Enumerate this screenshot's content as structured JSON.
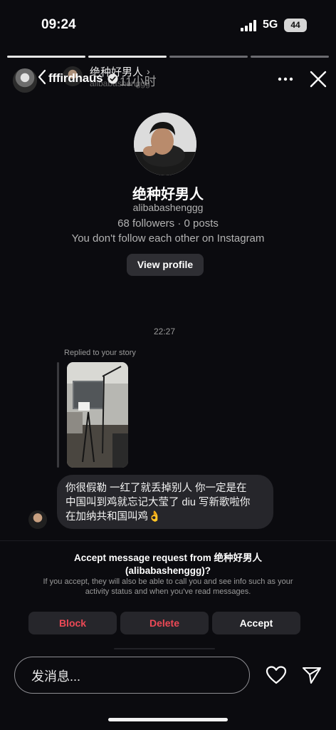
{
  "status_bar": {
    "time": "09:24",
    "network": "5G",
    "battery": "44"
  },
  "story_header": {
    "username": "fffirdhaus",
    "time_ago": "11小时",
    "progress_segments": 4,
    "progress_done": 2
  },
  "dm_header": {
    "name": "绝种好男人",
    "handle": "alibabashenggg"
  },
  "profile": {
    "name": "绝种好男人",
    "handle": "alibabashenggg",
    "stats": "68 followers · 0 posts",
    "follow_note": "You don't follow each other on Instagram",
    "view_profile_label": "View profile"
  },
  "conversation": {
    "timestamp": "22:27",
    "reply_label": "Replied to your story",
    "message_lines": [
      "你很假勒 一红了就丢掉别人 你一定是在",
      "中国叫到鸡就忘记大莹了 diu 写新歌啦你",
      "在加纳共和国叫鸡👌"
    ]
  },
  "request": {
    "title_line1": "Accept message request from 绝种好男人",
    "title_line2": "(alibabashenggg)?",
    "description": "If you accept, they will also be able to call you and see info such as your activity status and when you've read messages.",
    "block_label": "Block",
    "delete_label": "Delete",
    "accept_label": "Accept"
  },
  "composer": {
    "placeholder": "发消息..."
  },
  "colors": {
    "background": "#0b0b0f",
    "destructive": "#ed4956",
    "button_bg": "#26262b"
  }
}
